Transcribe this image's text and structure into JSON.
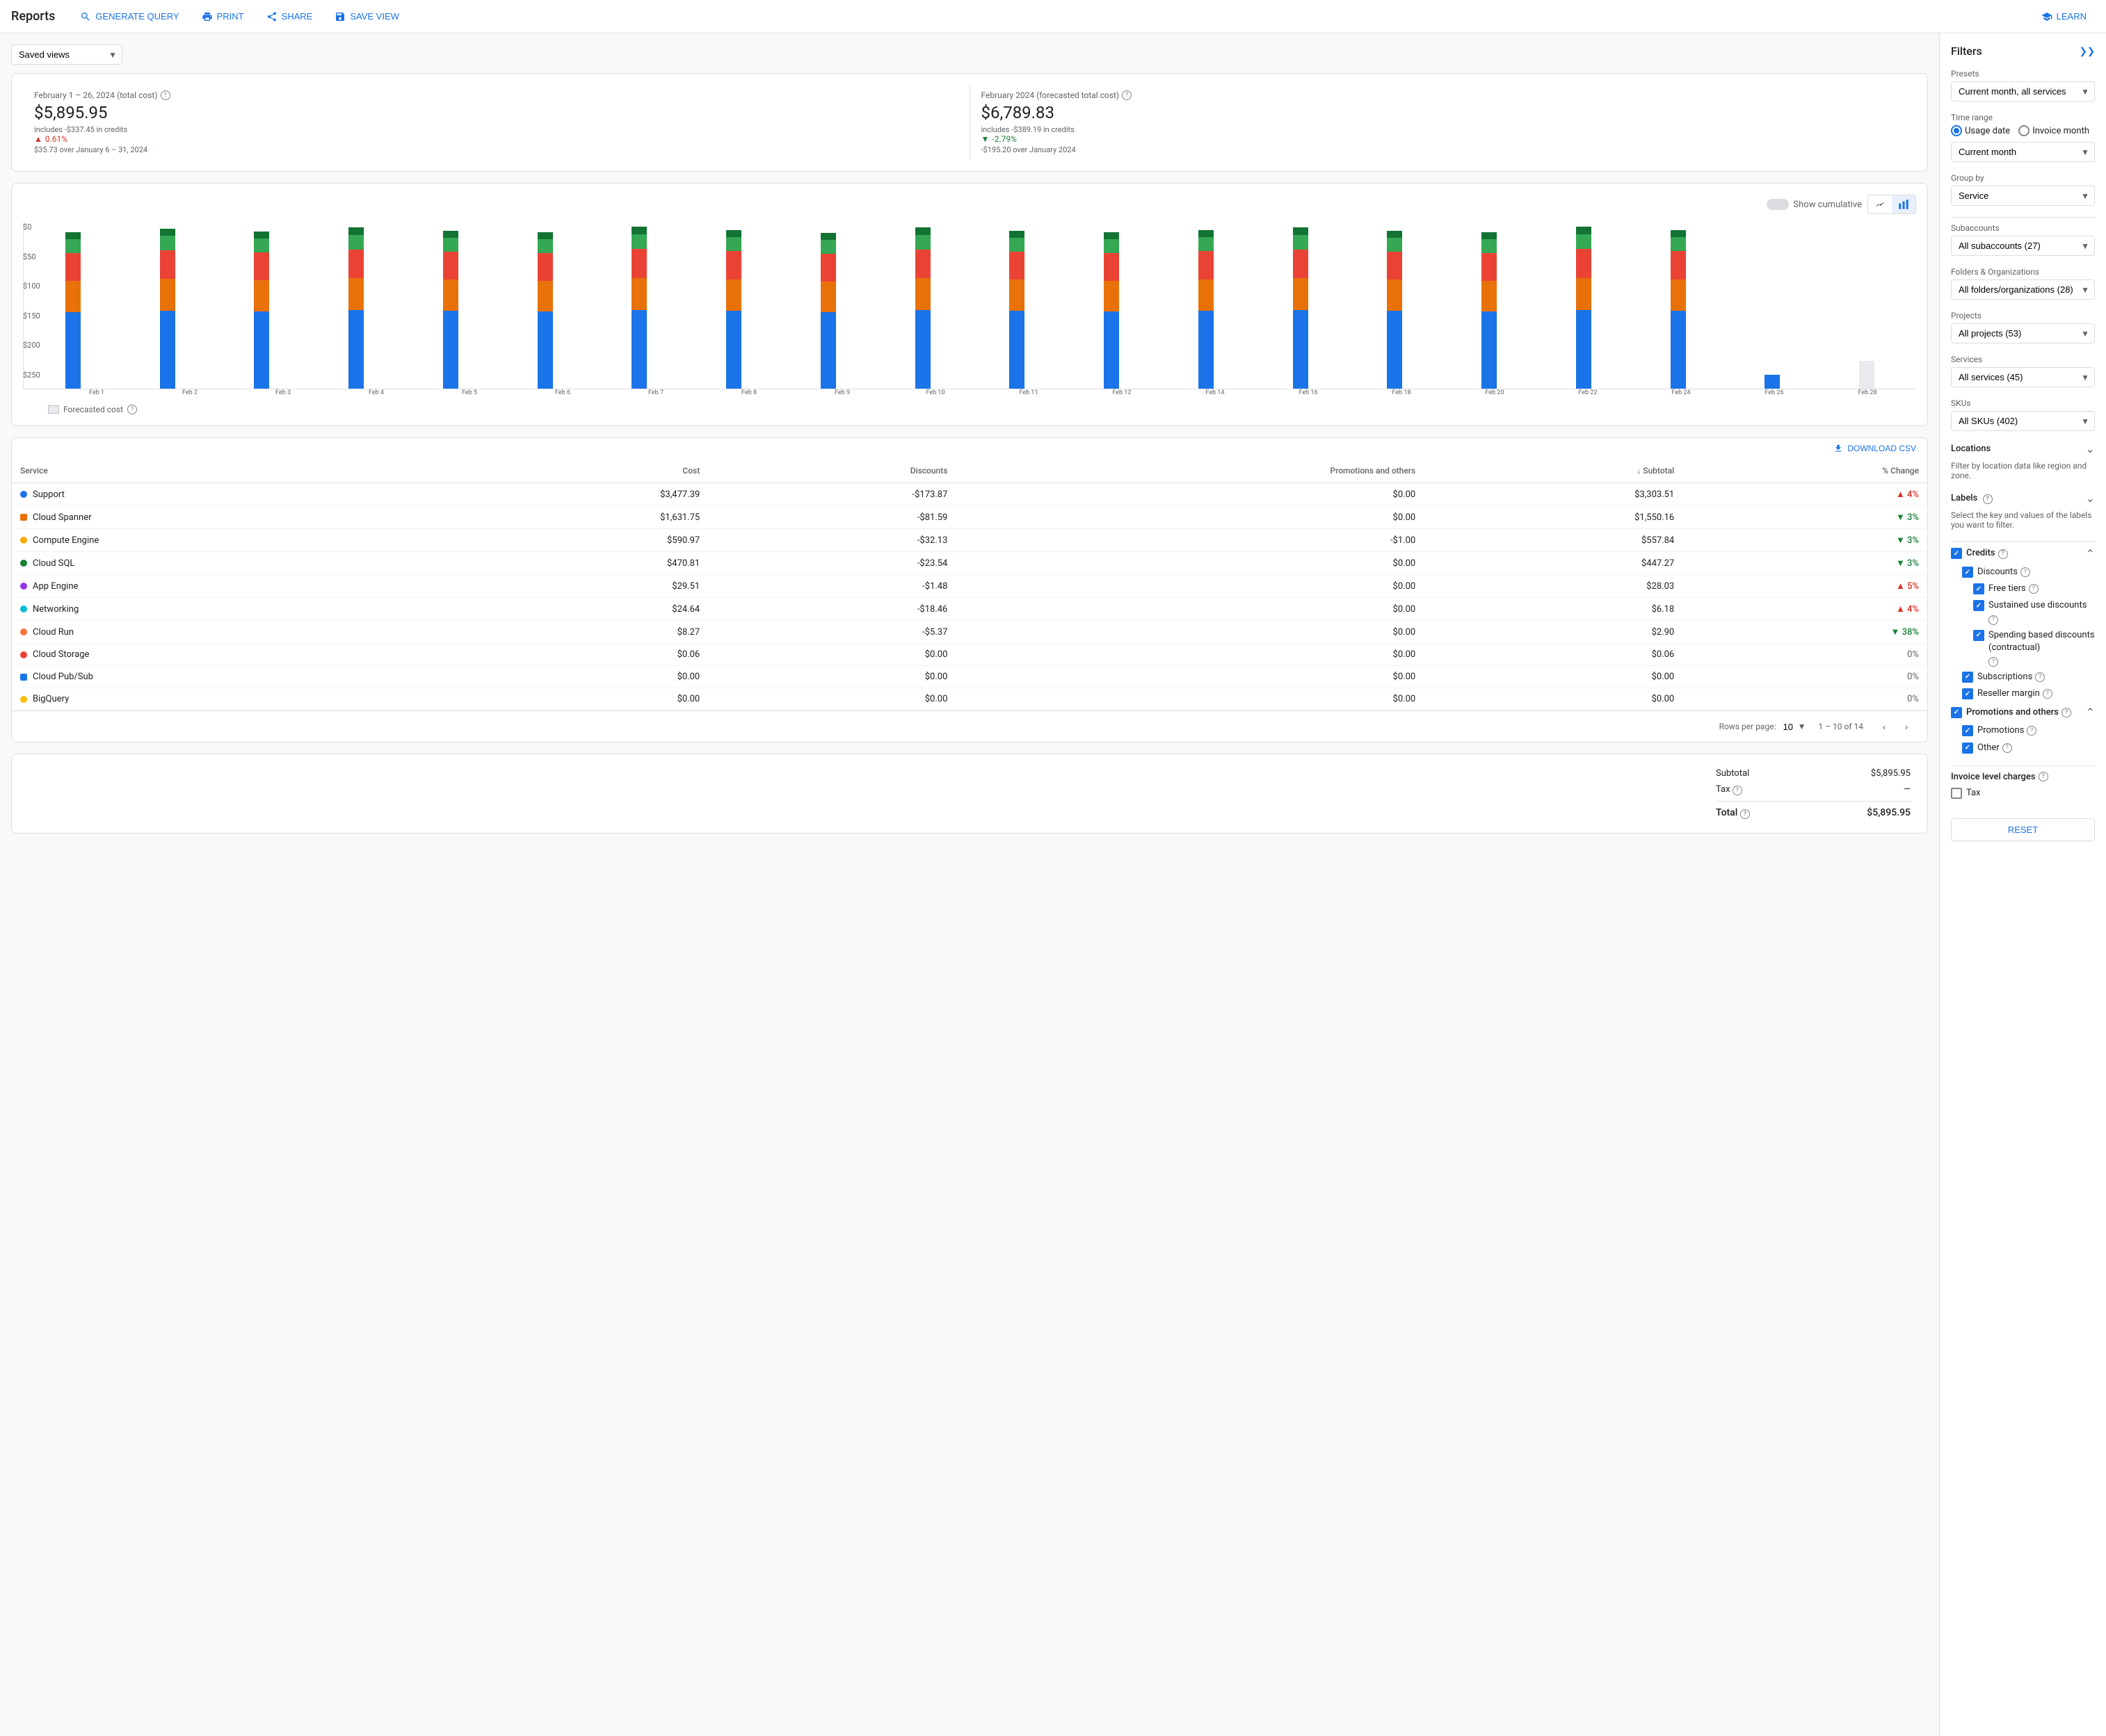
{
  "nav": {
    "title": "Reports",
    "buttons": [
      {
        "label": "GENERATE QUERY",
        "name": "generate-query"
      },
      {
        "label": "PRINT",
        "name": "print"
      },
      {
        "label": "SHARE",
        "name": "share"
      },
      {
        "label": "SAVE VIEW",
        "name": "save-view"
      }
    ],
    "learn_label": "LEARN"
  },
  "saved_views": {
    "label": "Saved views",
    "placeholder": "Saved views"
  },
  "stats": {
    "current": {
      "label": "February 1 – 26, 2024 (total cost)",
      "value": "$5,895.95",
      "change_pct": "0.61%",
      "change_direction": "up",
      "change_desc": "$35.73 over January 6 – 31, 2024",
      "sub": "includes -$337.45 in credits"
    },
    "forecasted": {
      "label": "February 2024 (forecasted total cost)",
      "value": "$6,789.83",
      "change_pct": "-2.79%",
      "change_direction": "down",
      "change_desc": "-$195.20 over January 2024",
      "sub": "includes -$389.19 in credits"
    }
  },
  "chart": {
    "cumulative_label": "Show cumulative",
    "y_labels": [
      "$250",
      "$200",
      "$150",
      "$100",
      "$50",
      "$0"
    ],
    "x_labels": [
      "Feb 1",
      "Feb 2",
      "Feb 3",
      "Feb 4",
      "Feb 5",
      "Feb 6",
      "Feb 7",
      "Feb 8",
      "Feb 9",
      "Feb 10",
      "Feb 11",
      "Feb 12",
      "Feb 14",
      "Feb 16",
      "Feb 18",
      "Feb 20",
      "Feb 22",
      "Feb 24",
      "Feb 26",
      "Feb 28"
    ],
    "forecasted_label": "Forecasted cost",
    "legend": [
      {
        "color": "#1a73e8",
        "label": "Support"
      },
      {
        "color": "#e8710a",
        "label": "Cloud Spanner"
      },
      {
        "color": "#f9ab00",
        "label": "Compute Engine"
      },
      {
        "color": "#188038",
        "label": "Cloud SQL"
      },
      {
        "color": "#9334e6",
        "label": "App Engine"
      }
    ]
  },
  "table": {
    "download_label": "DOWNLOAD CSV",
    "headers": [
      "Service",
      "Cost",
      "Discounts",
      "Promotions and others",
      "↓ Subtotal",
      "% Change"
    ],
    "rows": [
      {
        "color": "#1a73e8",
        "shape": "circle",
        "service": "Support",
        "cost": "$3,477.39",
        "discounts": "-$173.87",
        "promos": "$0.00",
        "subtotal": "$3,303.51",
        "change": "4%",
        "change_dir": "up"
      },
      {
        "color": "#e8710a",
        "shape": "square",
        "service": "Cloud Spanner",
        "cost": "$1,631.75",
        "discounts": "-$81.59",
        "promos": "$0.00",
        "subtotal": "$1,550.16",
        "change": "3%",
        "change_dir": "down"
      },
      {
        "color": "#f9ab00",
        "shape": "diamond",
        "service": "Compute Engine",
        "cost": "$590.97",
        "discounts": "-$32.13",
        "promos": "-$1.00",
        "subtotal": "$557.84",
        "change": "3%",
        "change_dir": "down"
      },
      {
        "color": "#188038",
        "shape": "triangle",
        "service": "Cloud SQL",
        "cost": "$470.81",
        "discounts": "-$23.54",
        "promos": "$0.00",
        "subtotal": "$447.27",
        "change": "3%",
        "change_dir": "down"
      },
      {
        "color": "#9334e6",
        "shape": "triangle-up",
        "service": "App Engine",
        "cost": "$29.51",
        "discounts": "-$1.48",
        "promos": "$0.00",
        "subtotal": "$28.03",
        "change": "5%",
        "change_dir": "up"
      },
      {
        "color": "#00bcd4",
        "shape": "circle",
        "service": "Networking",
        "cost": "$24.64",
        "discounts": "-$18.46",
        "promos": "$0.00",
        "subtotal": "$6.18",
        "change": "4%",
        "change_dir": "up"
      },
      {
        "color": "#ff7043",
        "shape": "plus",
        "service": "Cloud Run",
        "cost": "$8.27",
        "discounts": "-$5.37",
        "promos": "$0.00",
        "subtotal": "$2.90",
        "change": "38%",
        "change_dir": "down"
      },
      {
        "color": "#ea4335",
        "shape": "x",
        "service": "Cloud Storage",
        "cost": "$0.06",
        "discounts": "$0.00",
        "promos": "$0.00",
        "subtotal": "$0.06",
        "change": "0%",
        "change_dir": "neutral"
      },
      {
        "color": "#1a73e8",
        "shape": "square",
        "service": "Cloud Pub/Sub",
        "cost": "$0.00",
        "discounts": "$0.00",
        "promos": "$0.00",
        "subtotal": "$0.00",
        "change": "0%",
        "change_dir": "neutral"
      },
      {
        "color": "#fbbc04",
        "shape": "star",
        "service": "BigQuery",
        "cost": "$0.00",
        "discounts": "$0.00",
        "promos": "$0.00",
        "subtotal": "$0.00",
        "change": "0%",
        "change_dir": "neutral"
      }
    ],
    "pagination": {
      "rows_per_page_label": "Rows per page:",
      "rows_per_page_value": "10",
      "page_info": "1 – 10 of 14"
    }
  },
  "totals": {
    "subtotal_label": "Subtotal",
    "subtotal_value": "$5,895.95",
    "tax_label": "Tax",
    "tax_value": "—",
    "total_label": "Total",
    "total_value": "$5,895.95",
    "tax_help": true
  },
  "filters": {
    "title": "Filters",
    "presets_label": "Presets",
    "presets_value": "Current month, all services",
    "time_range_label": "Time range",
    "usage_date_label": "Usage date",
    "invoice_month_label": "Invoice month",
    "current_month_label": "Current month",
    "group_by_label": "Group by",
    "group_by_value": "Service",
    "subaccounts_label": "Subaccounts",
    "subaccounts_value": "All subaccounts (27)",
    "folders_label": "Folders & Organizations",
    "folders_value": "All folders/organizations (28)",
    "projects_label": "Projects",
    "projects_value": "All projects (53)",
    "services_label": "Services",
    "services_value": "All services (45)",
    "skus_label": "SKUs",
    "skus_value": "All SKUs (402)",
    "locations_label": "Locations",
    "locations_sub": "Filter by location data like region and zone.",
    "labels_label": "Labels",
    "labels_sub": "Select the key and values of the labels you want to filter.",
    "credits_label": "Credits",
    "discounts_label": "Discounts",
    "free_tiers_label": "Free tiers",
    "sustained_use_label": "Sustained use discounts",
    "spending_based_label": "Spending based discounts (contractual)",
    "subscriptions_label": "Subscriptions",
    "reseller_margin_label": "Reseller margin",
    "promos_others_label": "Promotions and others",
    "promotions_label": "Promotions",
    "other_label": "Other",
    "invoice_charges_label": "Invoice level charges",
    "tax_label": "Tax",
    "reset_label": "RESET"
  }
}
